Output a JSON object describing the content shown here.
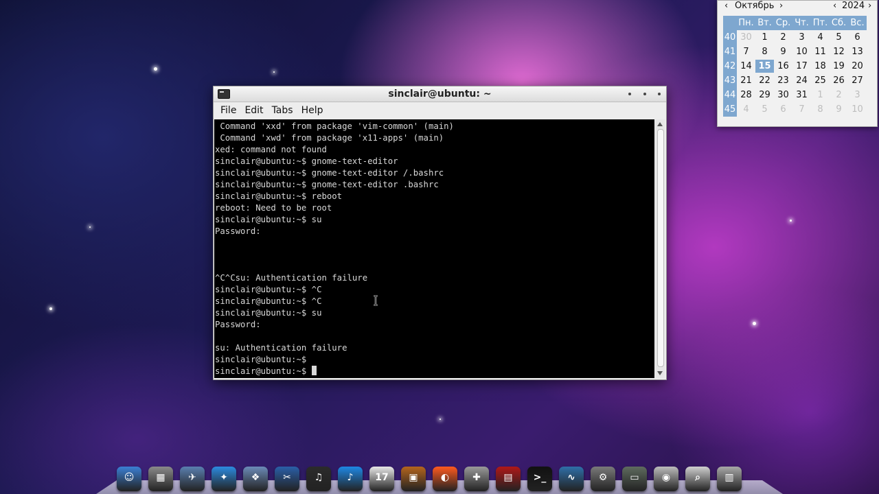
{
  "terminal": {
    "title": "sinclair@ubuntu: ~",
    "menu": [
      "File",
      "Edit",
      "Tabs",
      "Help"
    ],
    "lines": [
      " Command 'xxd' from package 'vim-common' (main)",
      " Command 'xwd' from package 'x11-apps' (main)",
      "xed: command not found",
      "sinclair@ubuntu:~$ gnome-text-editor",
      "sinclair@ubuntu:~$ gnome-text-editor /.bashrc",
      "sinclair@ubuntu:~$ gnome-text-editor .bashrc",
      "sinclair@ubuntu:~$ reboot",
      "reboot: Need to be root",
      "sinclair@ubuntu:~$ su",
      "Password:",
      "",
      "",
      "",
      "^C^Csu: Authentication failure",
      "sinclair@ubuntu:~$ ^C",
      "sinclair@ubuntu:~$ ^C",
      "sinclair@ubuntu:~$ su",
      "Password:",
      "",
      "su: Authentication failure",
      "sinclair@ubuntu:~$",
      "sinclair@ubuntu:~$ "
    ]
  },
  "calendar": {
    "month": "Октябрь",
    "year": "2024",
    "weekday_headers": [
      "Пн.",
      "Вт.",
      "Ср.",
      "Чт.",
      "Пт.",
      "Сб.",
      "Вс."
    ],
    "weeks": [
      {
        "num": "40",
        "days": [
          "30",
          "1",
          "2",
          "3",
          "4",
          "5",
          "6"
        ]
      },
      {
        "num": "41",
        "days": [
          "7",
          "8",
          "9",
          "10",
          "11",
          "12",
          "13"
        ]
      },
      {
        "num": "42",
        "days": [
          "14",
          "15",
          "16",
          "17",
          "18",
          "19",
          "20"
        ]
      },
      {
        "num": "43",
        "days": [
          "21",
          "22",
          "23",
          "24",
          "25",
          "26",
          "27"
        ]
      },
      {
        "num": "44",
        "days": [
          "28",
          "29",
          "30",
          "31",
          "1",
          "2",
          "3"
        ]
      },
      {
        "num": "45",
        "days": [
          "4",
          "5",
          "6",
          "7",
          "8",
          "9",
          "10"
        ]
      }
    ],
    "today": "15"
  },
  "dock": {
    "items": [
      {
        "name": "finder-icon",
        "color": "#3b7fd4",
        "glyph": "☺"
      },
      {
        "name": "calculator-icon",
        "color": "#8a8a8a",
        "glyph": "▦"
      },
      {
        "name": "photo-browser-icon",
        "color": "#5a7fb0",
        "glyph": "✈"
      },
      {
        "name": "safari-icon",
        "color": "#2c8be0",
        "glyph": "✦"
      },
      {
        "name": "image-viewer-icon",
        "color": "#6c8bb8",
        "glyph": "❖"
      },
      {
        "name": "video-editor-icon",
        "color": "#2a5fa8",
        "glyph": "✂"
      },
      {
        "name": "headphones-icon",
        "color": "#2b2b2b",
        "glyph": "♫"
      },
      {
        "name": "itunes-icon",
        "color": "#1e88e5",
        "glyph": "♪"
      },
      {
        "name": "calendar-icon",
        "color": "#e8e8e8",
        "glyph": "17"
      },
      {
        "name": "photos-icon",
        "color": "#b5651d",
        "glyph": "▣"
      },
      {
        "name": "media-player-icon",
        "color": "#ff5a1f",
        "glyph": "◐"
      },
      {
        "name": "joystick-icon",
        "color": "#9a9a9a",
        "glyph": "✚"
      },
      {
        "name": "photo-booth-icon",
        "color": "#b01818",
        "glyph": "▤"
      },
      {
        "name": "terminal-icon",
        "color": "#111111",
        "glyph": ">_"
      },
      {
        "name": "activity-monitor-icon",
        "color": "#2f6fa8",
        "glyph": "∿"
      },
      {
        "name": "system-preferences-icon",
        "color": "#7a7a7a",
        "glyph": "⚙"
      },
      {
        "name": "drive-icon",
        "color": "#5f6b5f",
        "glyph": "▭"
      },
      {
        "name": "disk-utility-icon",
        "color": "#bcbcbc",
        "glyph": "◉"
      },
      {
        "name": "search-icon",
        "color": "#d0d0d0",
        "glyph": "⌕"
      },
      {
        "name": "trash-icon",
        "color": "#a8a8a8",
        "glyph": "▥"
      }
    ]
  }
}
